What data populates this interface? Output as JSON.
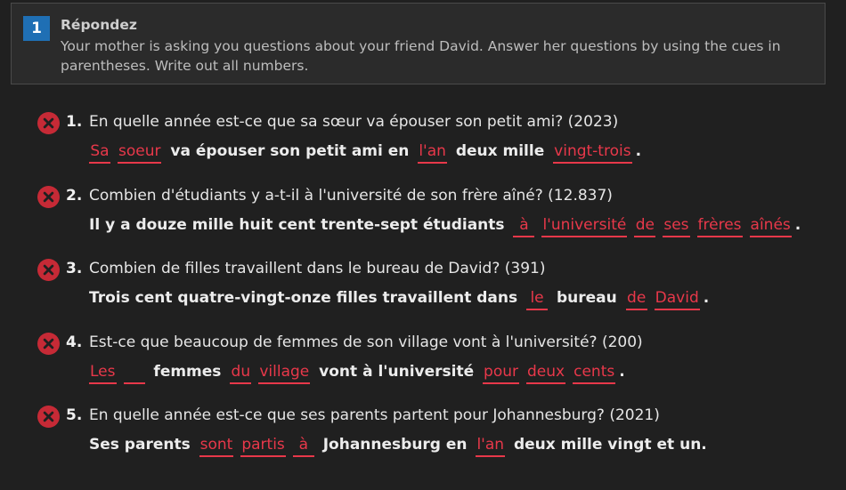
{
  "header": {
    "number": "1",
    "title": "Répondez",
    "instructions": "Your mother is asking you questions about your friend David. Answer her questions by using the cues in parentheses. Write out all numbers."
  },
  "colors": {
    "accent": "#1f6fb4",
    "error": "#c62a36",
    "blank_text": "#e8384a"
  },
  "items": [
    {
      "number": "1.",
      "question": "En quelle année est-ce que sa sœur va épouser son petit ami? (2023)",
      "answer": [
        {
          "t": "blank",
          "v": "Sa"
        },
        {
          "t": "blank",
          "v": "soeur"
        },
        {
          "t": "text",
          "v": " va épouser son petit ami en "
        },
        {
          "t": "blank",
          "v": "l'an"
        },
        {
          "t": "text",
          "v": " deux mille "
        },
        {
          "t": "blank",
          "v": "vingt-trois"
        },
        {
          "t": "text",
          "v": "."
        }
      ]
    },
    {
      "number": "2.",
      "question": "Combien d'étudiants y a-t-il à l'université de son frère aîné? (12.837)",
      "answer": [
        {
          "t": "text",
          "v": "Il y a douze mille huit cent trente-sept étudiants "
        },
        {
          "t": "blank",
          "v": "à"
        },
        {
          "t": "blank",
          "v": "l'université"
        },
        {
          "t": "blank",
          "v": "de"
        },
        {
          "t": "blank",
          "v": "ses"
        },
        {
          "t": "blank",
          "v": "frères"
        },
        {
          "t": "blank",
          "v": "aînés"
        },
        {
          "t": "text",
          "v": "."
        }
      ]
    },
    {
      "number": "3.",
      "question": "Combien de filles travaillent dans le bureau de David? (391)",
      "answer": [
        {
          "t": "text",
          "v": "Trois cent quatre-vingt-onze filles travaillent dans "
        },
        {
          "t": "blank",
          "v": "le"
        },
        {
          "t": "text",
          "v": " bureau "
        },
        {
          "t": "blank",
          "v": "de"
        },
        {
          "t": "blank",
          "v": "David"
        },
        {
          "t": "text",
          "v": "."
        }
      ]
    },
    {
      "number": "4.",
      "question": "Est-ce que beaucoup de femmes de son village vont à l'université? (200)",
      "answer": [
        {
          "t": "blank",
          "v": "Les"
        },
        {
          "t": "blank",
          "v": ""
        },
        {
          "t": "text",
          "v": " femmes "
        },
        {
          "t": "blank",
          "v": "du"
        },
        {
          "t": "blank",
          "v": "village"
        },
        {
          "t": "text",
          "v": " vont à l'université "
        },
        {
          "t": "blank",
          "v": "pour"
        },
        {
          "t": "blank",
          "v": "deux"
        },
        {
          "t": "blank",
          "v": "cents"
        },
        {
          "t": "text",
          "v": "."
        }
      ]
    },
    {
      "number": "5.",
      "question": "En quelle année est-ce que ses parents partent pour Johannesburg? (2021)",
      "answer": [
        {
          "t": "text",
          "v": "Ses parents "
        },
        {
          "t": "blank",
          "v": "sont"
        },
        {
          "t": "blank",
          "v": "partis"
        },
        {
          "t": "blank",
          "v": "à"
        },
        {
          "t": "text",
          "v": " Johannesburg en "
        },
        {
          "t": "blank",
          "v": "l'an"
        },
        {
          "t": "text",
          "v": " deux mille vingt et un."
        }
      ]
    }
  ]
}
